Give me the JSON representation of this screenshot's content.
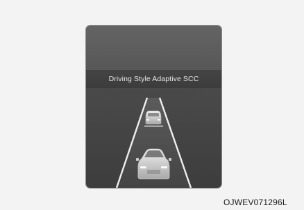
{
  "display": {
    "message": "Driving Style Adaptive SCC",
    "icons": [
      "road-lanes-icon",
      "lead-vehicle-icon",
      "own-vehicle-icon"
    ]
  },
  "figure": {
    "code": "OJWEV071296L"
  },
  "colors": {
    "screen_background": "#4a4a4a",
    "banner_background": "#3f3f3f",
    "banner_text": "#e9e9e9",
    "lane_lines": "#eeeeee",
    "vehicle_body": "#d9d9d9"
  }
}
